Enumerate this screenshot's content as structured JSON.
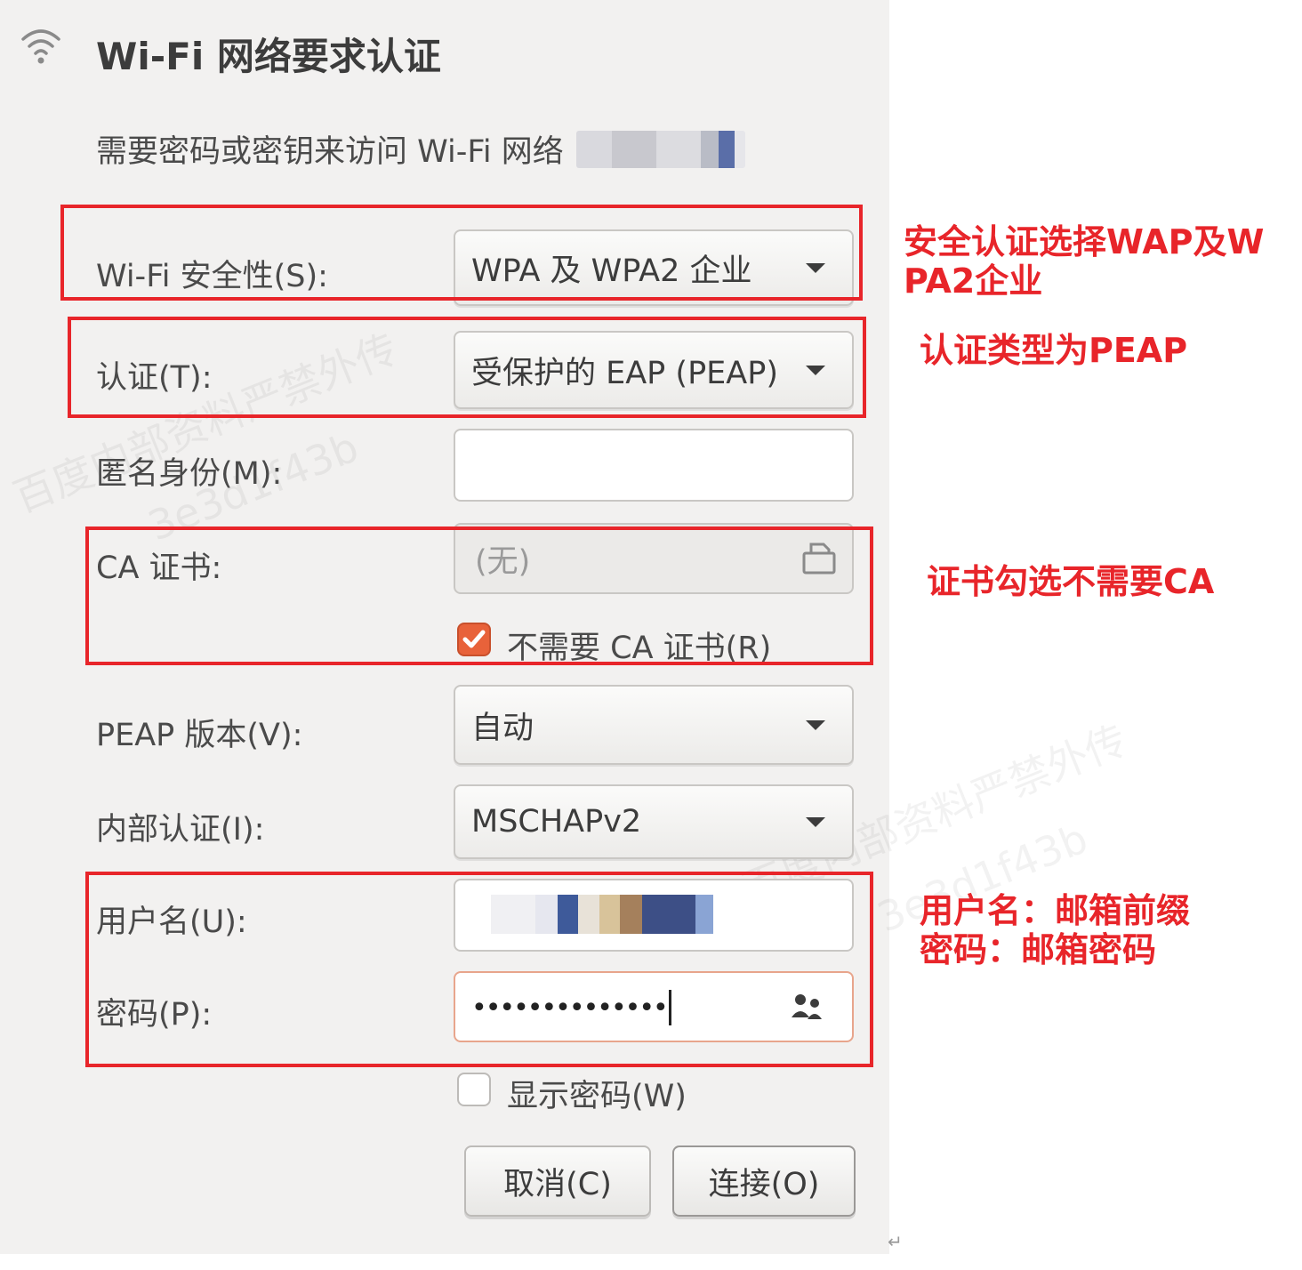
{
  "dialog": {
    "title": "Wi-Fi 网络要求认证",
    "description": "需要密码或密钥来访问 Wi-Fi 网络"
  },
  "fields": {
    "security_label": "Wi-Fi 安全性(S):",
    "security_value": "WPA 及 WPA2 企业",
    "auth_label": "认证(T):",
    "auth_value": "受保护的 EAP (PEAP)",
    "anon_label": "匿名身份(M):",
    "anon_value": "",
    "ca_label": "CA 证书:",
    "ca_value": "(无)",
    "no_ca_label": "不需要 CA 证书(R)",
    "no_ca_checked": true,
    "peap_label": "PEAP 版本(V):",
    "peap_value": "自动",
    "inner_label": "内部认证(I):",
    "inner_value": "MSCHAPv2",
    "username_label": "用户名(U):",
    "password_label": "密码(P):",
    "password_value": "••••••••••••••",
    "show_pw_label": "显示密码(W)",
    "show_pw_checked": false
  },
  "buttons": {
    "cancel": "取消(C)",
    "connect": "连接(O)"
  },
  "annotations": {
    "security_note": "安全认证选择WAP及WPA2企业",
    "auth_note": "认证类型为PEAP",
    "ca_note": "证书勾选不需要CA",
    "credentials_note_1": "用户名：邮箱前缀",
    "credentials_note_2": "密码：邮箱密码"
  },
  "watermark": {
    "line1": "百度内部资料严禁外传",
    "line2": "3e3d1f43b"
  },
  "colors": {
    "annotation_red": "#e8252a",
    "checkbox_orange": "#e8623a",
    "dialog_bg": "#f2f1f0"
  },
  "icons": [
    "wifi-icon",
    "dropdown-arrow-icon",
    "file-chooser-icon",
    "checkmark-icon",
    "key-users-icon"
  ]
}
